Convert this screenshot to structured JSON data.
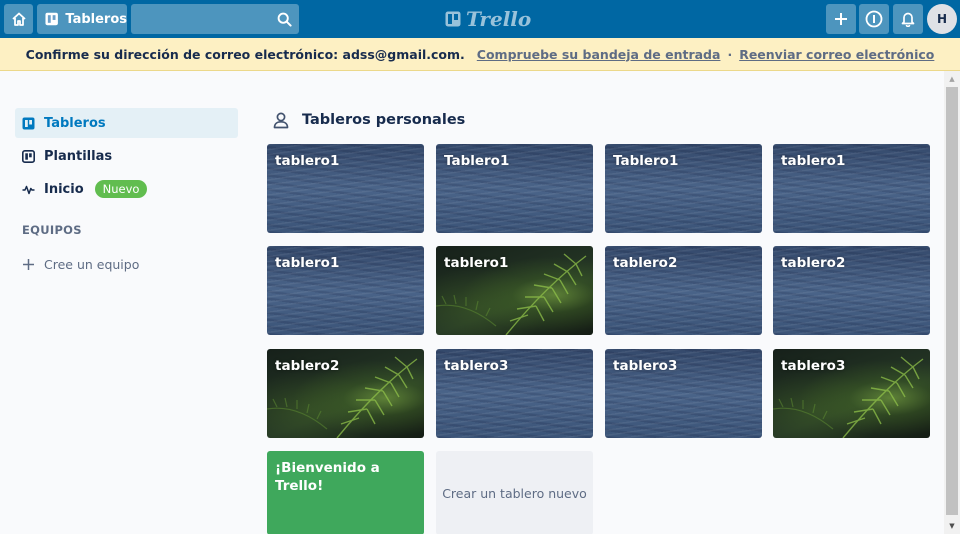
{
  "header": {
    "boards_label": "Tableros",
    "logo_text": "Trello",
    "avatar_initial": "H"
  },
  "banner": {
    "message": "Confirme su dirección de correo electrónico: adss@gmail.com.",
    "check_inbox": "Compruebe su bandeja de entrada",
    "separator": "·",
    "resend": "Reenviar correo electrónico"
  },
  "sidebar": {
    "items": [
      {
        "label": "Tableros",
        "icon": "board-icon"
      },
      {
        "label": "Plantillas",
        "icon": "template-icon"
      },
      {
        "label": "Inicio",
        "icon": "activity-icon",
        "badge": "Nuevo"
      }
    ],
    "teams_title": "EQUIPOS",
    "create_team": "Cree un equipo"
  },
  "main": {
    "section_title": "Tableros personales",
    "boards": [
      {
        "name": "tablero1",
        "background": "water"
      },
      {
        "name": "Tablero1",
        "background": "water"
      },
      {
        "name": "Tablero1",
        "background": "water"
      },
      {
        "name": "tablero1",
        "background": "water"
      },
      {
        "name": "tablero1",
        "background": "water"
      },
      {
        "name": "tablero1",
        "background": "fern"
      },
      {
        "name": "tablero2",
        "background": "water"
      },
      {
        "name": "tablero2",
        "background": "water"
      },
      {
        "name": "tablero2",
        "background": "fern"
      },
      {
        "name": "tablero3",
        "background": "water"
      },
      {
        "name": "tablero3",
        "background": "water"
      },
      {
        "name": "tablero3",
        "background": "fern"
      }
    ],
    "welcome_board": "¡Bienvenido a Trello!",
    "create_board": "Crear un tablero nuevo"
  },
  "colors": {
    "header": "#0067a3",
    "banner": "#fdf0c3",
    "active_item": "#e4f0f6",
    "accent": "#0079bf",
    "badge_new": "#61bd4f",
    "welcome_tile": "#3fa85c"
  }
}
